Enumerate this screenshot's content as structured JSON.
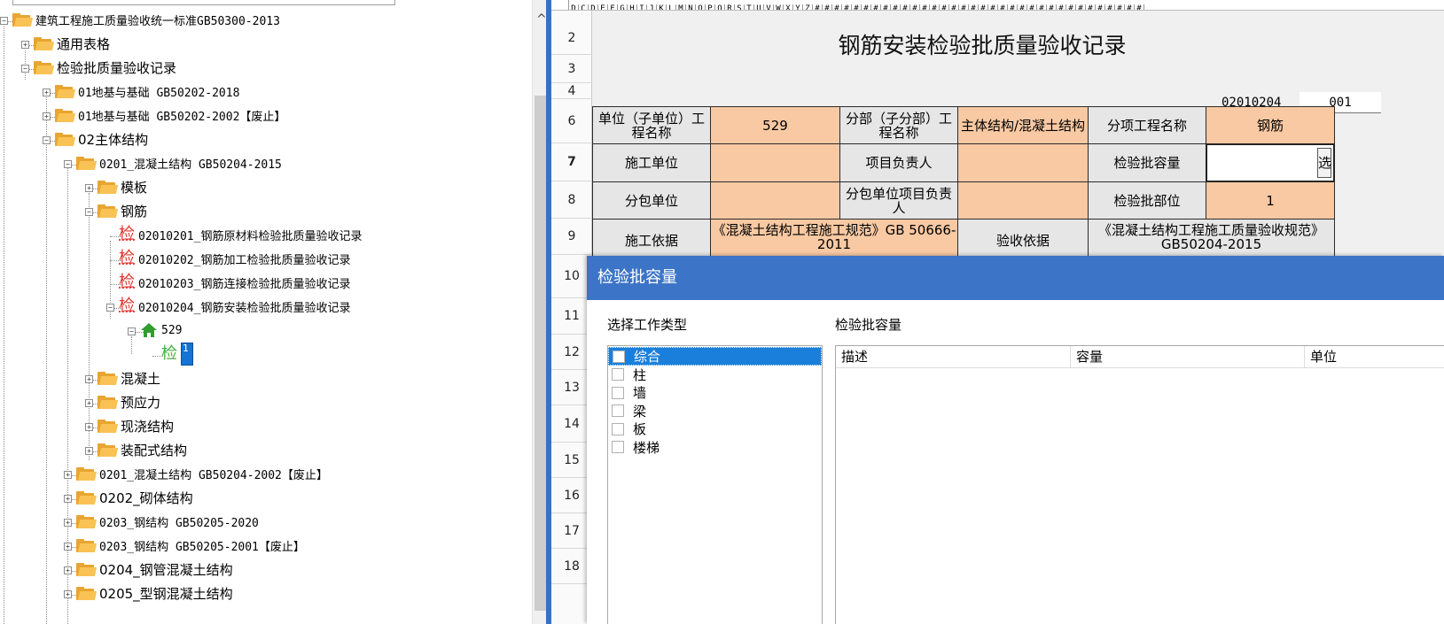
{
  "tree": {
    "nodes": [
      {
        "label": "建筑工程施工质量验收统一标准GB50300-2013"
      },
      {
        "label": "通用表格"
      },
      {
        "label": "检验批质量验收记录"
      },
      {
        "label": "01地基与基础 GB50202-2018"
      },
      {
        "label": "01地基与基础 GB50202-2002【废止】"
      },
      {
        "label": "02主体结构"
      },
      {
        "label": "0201_混凝土结构 GB50204-2015"
      },
      {
        "label": "模板"
      },
      {
        "label": "钢筋"
      },
      {
        "label": "02010201_钢筋原材料检验批质量验收记录"
      },
      {
        "label": "02010202_钢筋加工检验批质量验收记录"
      },
      {
        "label": "02010203_钢筋连接检验批质量验收记录"
      },
      {
        "label": "02010204_钢筋安装检验批质量验收记录"
      },
      {
        "label": "529"
      },
      {
        "label": "1"
      },
      {
        "label": "混凝土"
      },
      {
        "label": "预应力"
      },
      {
        "label": "现浇结构"
      },
      {
        "label": "装配式结构"
      },
      {
        "label": "0201_混凝土结构 GB50204-2002【废止】"
      },
      {
        "label": "0202_砌体结构"
      },
      {
        "label": "0203_钢结构 GB50205-2020"
      },
      {
        "label": "0203_钢结构 GB50205-2001【废止】"
      },
      {
        "label": "0204_钢管混凝土结构"
      },
      {
        "label": "0205_型钢混凝土结构"
      }
    ],
    "jian_glyph": "检",
    "expand_glyph": "+",
    "collapse_glyph": "−"
  },
  "sheet": {
    "column_letters": "DCDEFGHIJKLMNOPQRSTUVWXYZ##################################",
    "row_numbers": [
      "2",
      "3",
      "4",
      "6",
      "7",
      "8",
      "9",
      "10",
      "11",
      "12",
      "13",
      "14",
      "15",
      "16",
      "17",
      "18"
    ],
    "title": "钢筋安装检验批质量验收记录",
    "code_label": "02010204",
    "code_value": "001",
    "select_button": "选",
    "cells": {
      "unit_name_label": "单位（子单位）工程名称",
      "unit_name_value": "529",
      "division_label": "分部（子分部）工程名称",
      "division_value": "主体结构/混凝土结构",
      "item_label": "分项工程名称",
      "item_value": "钢筋",
      "contractor_label": "施工单位",
      "contractor_value": "",
      "manager_label": "项目负责人",
      "manager_value": "",
      "capacity_label": "检验批容量",
      "capacity_value": "",
      "sub_label": "分包单位",
      "sub_value": "",
      "sub_manager_label": "分包单位项目负责人",
      "sub_manager_value": "",
      "location_label": "检验批部位",
      "location_value": "1",
      "basis_label": "施工依据",
      "basis_value": "《混凝土结构工程施工规范》GB 50666-2011",
      "accept_label": "验收依据",
      "accept_value": "《混凝土结构工程施工质量验收规范》GB50204-2015"
    }
  },
  "dialog": {
    "title": "检验批容量",
    "type_label": "选择工作类型",
    "capacity_label": "检验批容量",
    "types": [
      "综合",
      "柱",
      "墙",
      "梁",
      "板",
      "楼梯"
    ],
    "selected_type": "综合",
    "columns": [
      "描述",
      "容量",
      "单位"
    ]
  },
  "colors": {
    "accent": "#3c75c7",
    "selection": "#1a7fdb",
    "input_cell": "#f8c9a3",
    "label_cell": "#e6e6e6",
    "folder": "#f9c255"
  }
}
